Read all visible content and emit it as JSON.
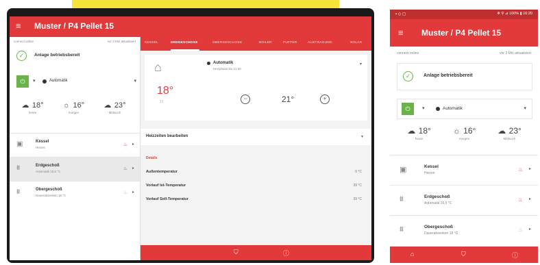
{
  "app": {
    "title": "Muster / P4 Pellet 15",
    "menu_icon": "≡"
  },
  "connection": {
    "status": "connect online",
    "updated": "vor 3 Min aktualisiert"
  },
  "system": {
    "ready_label": "Anlage betriebsbereit",
    "mode_label": "Automatik"
  },
  "weather": [
    {
      "value": "18°",
      "label": "heute"
    },
    {
      "value": "16°",
      "label": "morgen"
    },
    {
      "value": "23°",
      "label": "Mittwoch"
    }
  ],
  "components": [
    {
      "name": "Kessel",
      "sub": "Heizen",
      "active": true
    },
    {
      "name": "Erdgeschoß",
      "sub": "Automatik 19,5 °C",
      "active": true
    },
    {
      "name": "Obergeschoß",
      "sub": "Dauerabsenken 18 °C",
      "active": false
    }
  ],
  "tabs": [
    "KESSEL",
    "ERDGESCHOSS",
    "OBERGESCHOSS",
    "BOILER",
    "PUFFER",
    "AUSTRAGUNG",
    "SOLAR"
  ],
  "zone": {
    "current_temp": "18°",
    "current_sub": "21",
    "mode": "Automatik",
    "mode_sub": "Heizphase bis 21:30",
    "setpoint": "21°"
  },
  "schedule_label": "Heizzeiten bearbeiten",
  "details": {
    "heading": "Details",
    "rows": [
      {
        "label": "Außentemperatur",
        "value": "6 °C"
      },
      {
        "label": "Vorlauf Ist-Temperatur",
        "value": "39 °C"
      },
      {
        "label": "Vorlauf Soll-Temperatur",
        "value": "39 °C"
      }
    ]
  },
  "phone_status": {
    "left": "▪ ◇ ◻",
    "right": "❄ ⚲ ⊿ 100% ▮ 16:20"
  },
  "colors": {
    "accent": "#e23a3a",
    "ok": "#6bb24a",
    "banner": "#f7e43a"
  }
}
